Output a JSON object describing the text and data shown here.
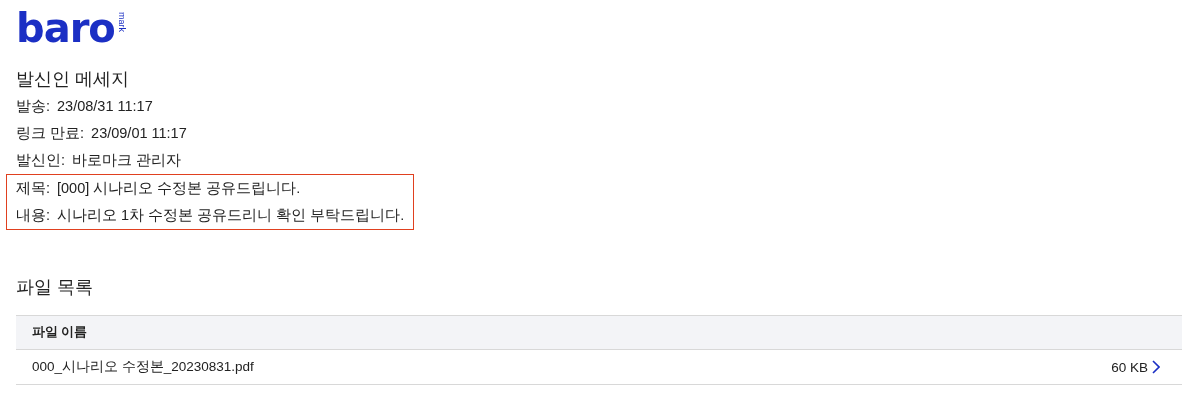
{
  "logo": {
    "word": "baro",
    "tag": "mark"
  },
  "message": {
    "title": "발신인 메세지",
    "fields": [
      {
        "label": "발송:",
        "value": "23/08/31 11:17"
      },
      {
        "label": "링크 만료:",
        "value": "23/09/01 11:17"
      },
      {
        "label": "발신인:",
        "value": "바로마크 관리자"
      }
    ],
    "highlighted_fields": [
      {
        "label": "제목:",
        "value": "[000] 시나리오 수정본 공유드립니다."
      },
      {
        "label": "내용:",
        "value": "시나리오 1차 수정본 공유드리니 확인 부탁드립니다."
      }
    ]
  },
  "files": {
    "title": "파일 목록",
    "columns": [
      "파일 이름"
    ],
    "rows": [
      {
        "name": "000_시나리오 수정본_20230831.pdf",
        "size": "60 KB"
      }
    ]
  }
}
